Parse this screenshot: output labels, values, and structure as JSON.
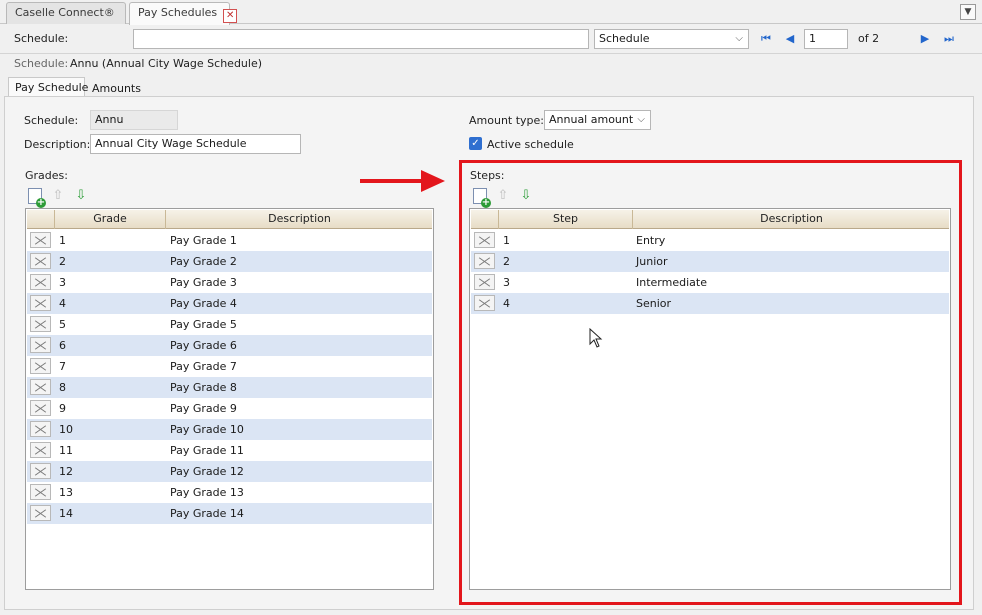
{
  "tabs": [
    {
      "label": "Caselle Connect®",
      "active": false
    },
    {
      "label": "Pay Schedules",
      "active": true
    }
  ],
  "toolbar": {
    "schedule_label": "Schedule:",
    "schedule_search_value": "",
    "type_select_value": "Schedule",
    "record_number": "1",
    "record_total": "of 2"
  },
  "current": {
    "label": "Schedule:",
    "value": "Annu (Annual City Wage Schedule)"
  },
  "subtabs": [
    "Pay Schedule",
    "Amounts"
  ],
  "form": {
    "schedule_label": "Schedule:",
    "schedule_value": "Annu",
    "description_label": "Description:",
    "description_value": "Annual City Wage Schedule",
    "amount_type_label": "Amount type:",
    "amount_type_value": "Annual amount",
    "active_label": "Active schedule",
    "active_checked": true
  },
  "grades": {
    "label": "Grades:",
    "columns": [
      "Grade",
      "Description"
    ],
    "rows": [
      {
        "code": "1",
        "desc": "Pay Grade 1"
      },
      {
        "code": "2",
        "desc": "Pay Grade 2"
      },
      {
        "code": "3",
        "desc": "Pay Grade 3"
      },
      {
        "code": "4",
        "desc": "Pay Grade 4"
      },
      {
        "code": "5",
        "desc": "Pay Grade 5"
      },
      {
        "code": "6",
        "desc": "Pay Grade 6"
      },
      {
        "code": "7",
        "desc": "Pay Grade 7"
      },
      {
        "code": "8",
        "desc": "Pay Grade 8"
      },
      {
        "code": "9",
        "desc": "Pay Grade 9"
      },
      {
        "code": "10",
        "desc": "Pay Grade 10"
      },
      {
        "code": "11",
        "desc": "Pay Grade 11"
      },
      {
        "code": "12",
        "desc": "Pay Grade 12"
      },
      {
        "code": "13",
        "desc": "Pay Grade 13"
      },
      {
        "code": "14",
        "desc": "Pay Grade 14"
      }
    ]
  },
  "steps": {
    "label": "Steps:",
    "columns": [
      "Step",
      "Description"
    ],
    "rows": [
      {
        "code": "1",
        "desc": "Entry"
      },
      {
        "code": "2",
        "desc": "Junior"
      },
      {
        "code": "3",
        "desc": "Intermediate"
      },
      {
        "code": "4",
        "desc": "Senior"
      }
    ]
  },
  "icons": {
    "add": "add-row-icon",
    "up": "move-up-icon",
    "down": "move-down-icon",
    "delete": "delete-row-icon"
  },
  "colors": {
    "highlight": "#e3161c",
    "alt_row": "#dbe5f4",
    "accent": "#2f6fd0"
  }
}
